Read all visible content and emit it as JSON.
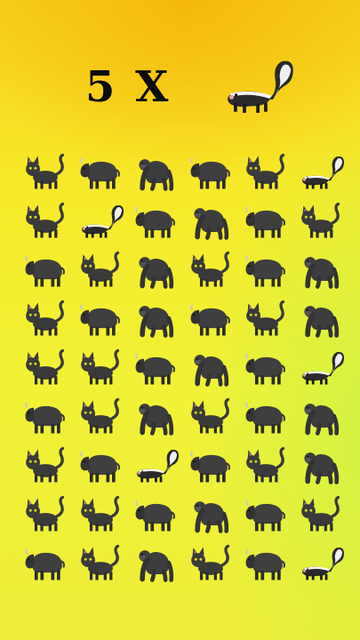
{
  "header": {
    "count_text": "5 X",
    "target_icon": "skunk-icon"
  },
  "grid": {
    "rows": [
      [
        "cat",
        "bison",
        "gorilla",
        "bison",
        "cat",
        "skunk"
      ],
      [
        "cat",
        "skunk",
        "bison",
        "gorilla",
        "bison",
        "cat"
      ],
      [
        "bison",
        "cat",
        "gorilla",
        "cat",
        "bison",
        "gorilla"
      ],
      [
        "cat",
        "bison",
        "gorilla",
        "bison",
        "cat",
        "gorilla"
      ],
      [
        "cat",
        "cat",
        "bison",
        "gorilla",
        "bison",
        "skunk"
      ],
      [
        "bison",
        "cat",
        "gorilla",
        "cat",
        "bison",
        "gorilla"
      ],
      [
        "cat",
        "bison",
        "skunk",
        "bison",
        "cat",
        "gorilla"
      ],
      [
        "cat",
        "cat",
        "bison",
        "gorilla",
        "bison",
        "cat"
      ],
      [
        "bison",
        "cat",
        "gorilla",
        "cat",
        "bison",
        "skunk"
      ]
    ]
  }
}
